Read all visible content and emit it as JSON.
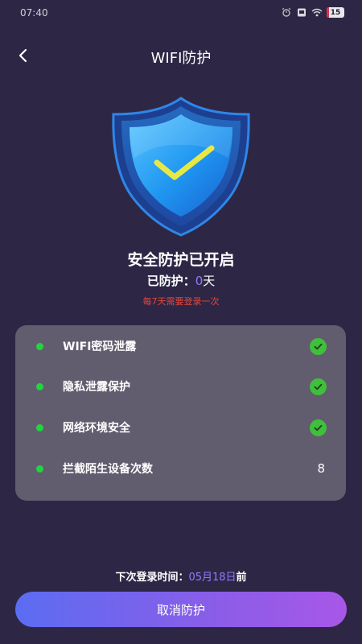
{
  "status_bar": {
    "time": "07:40",
    "battery": "15",
    "icons": [
      "alarm-icon",
      "card-icon",
      "wifi-icon",
      "battery-icon"
    ]
  },
  "header": {
    "title": "WIFI防护",
    "back_icon": "chevron-left-icon"
  },
  "shield": {
    "icon": "shield-check-icon",
    "colors": {
      "glow": "#2f7de6",
      "body": "#29a6f5",
      "check": "#e8e845"
    }
  },
  "status": {
    "title": "安全防护已开启",
    "protected_label": "已防护：",
    "protected_days": "0",
    "protected_unit": "天",
    "note": "每7天需要登录一次"
  },
  "checklist": {
    "items": [
      {
        "label": "WIFI密码泄露",
        "state": "check"
      },
      {
        "label": "隐私泄露保护",
        "state": "check"
      },
      {
        "label": "网络环境安全",
        "state": "check"
      },
      {
        "label": "拦截陌生设备次数",
        "value": "8"
      }
    ],
    "colors": {
      "dot": "#22d43d",
      "check": "#3fbf3b",
      "card": "#625c6f"
    }
  },
  "next_login": {
    "label": "下次登录时间：",
    "date": "05月18日",
    "suffix": "前"
  },
  "cancel_button": {
    "label": "取消防护"
  },
  "theme": {
    "background": "#2d2745",
    "accent": "#8f7bff",
    "warning": "#e8453c"
  }
}
